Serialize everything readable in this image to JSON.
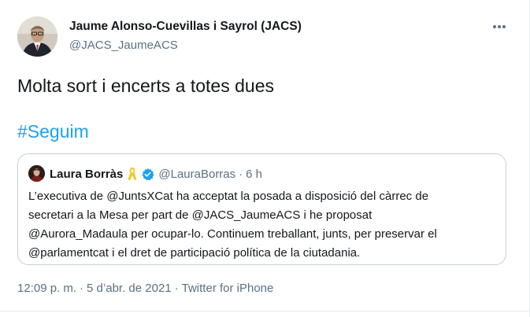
{
  "tweet": {
    "author": {
      "name": "Jaume Alonso-Cuevillas i Sayrol (JACS)",
      "handle": "@JACS_JaumeACS"
    },
    "more_icon": "more-horizontal-icon",
    "text": "Molta sort i encerts a totes dues",
    "hashtag": "#Seguim",
    "quoted": {
      "name": "Laura Borràs",
      "ribbon_icon": "yellow-ribbon-icon",
      "verified_icon": "verified-badge-icon",
      "handle": "@LauraBorras",
      "separator": "·",
      "time": "6 h",
      "lines": [
        "L’executiva de @JuntsXCat ha acceptat la posada a disposició del càrrec de",
        "secretari a la Mesa per part de @JACS_JaumeACS i he proposat",
        "@Aurora_Madaula per ocupar-lo. Continuem treballant, junts, per preservar el",
        "@parlamentcat i el dret de participació política de la ciutadania."
      ]
    },
    "meta": {
      "time": "12:09 p. m.",
      "separator": "·",
      "date": "5 d’abr. de 2021",
      "source": "Twitter for iPhone"
    }
  },
  "colors": {
    "link_blue": "#1da1f2",
    "secondary_text": "#5b7083",
    "border": "#c4cfd6",
    "ribbon_yellow": "#f5c518"
  }
}
